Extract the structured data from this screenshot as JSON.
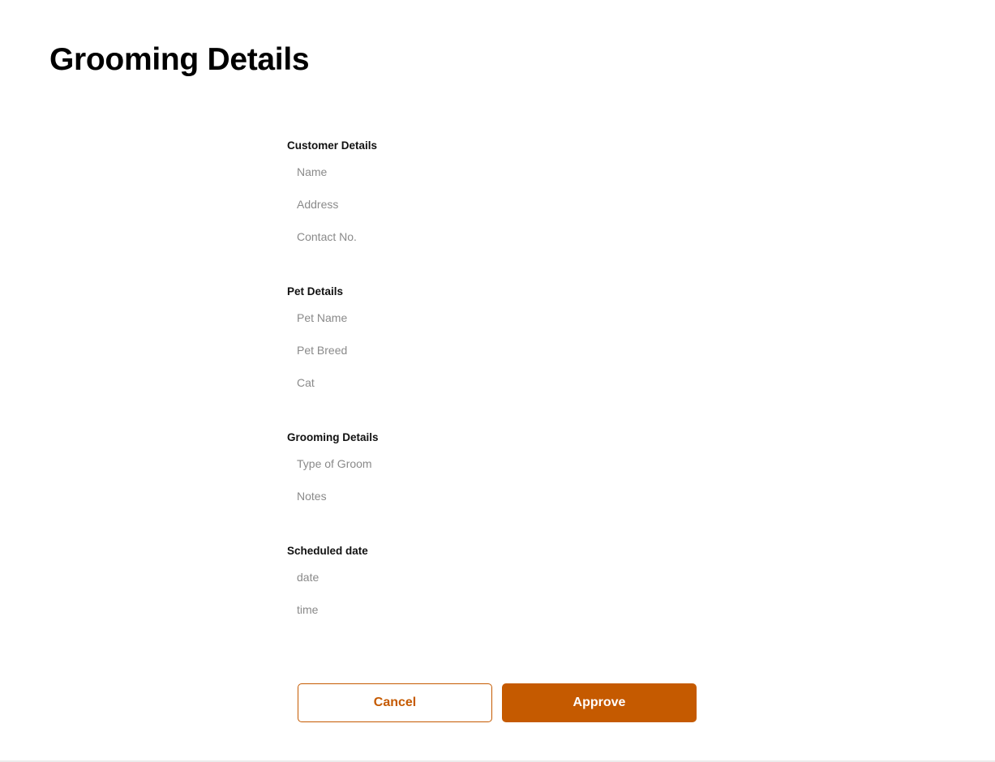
{
  "page": {
    "title": "Grooming Details"
  },
  "customer": {
    "heading": "Customer Details",
    "name_placeholder": "Name",
    "address_placeholder": "Address",
    "contact_placeholder": "Contact No."
  },
  "pet": {
    "heading": "Pet Details",
    "name_placeholder": "Pet Name",
    "breed_placeholder": "Pet Breed",
    "type_placeholder": "Cat"
  },
  "grooming": {
    "heading": "Grooming Details",
    "type_placeholder": "Type of Groom",
    "notes_placeholder": "Notes"
  },
  "schedule": {
    "heading": "Scheduled date",
    "date_placeholder": "date",
    "time_placeholder": "time"
  },
  "actions": {
    "cancel_label": "Cancel",
    "approve_label": "Approve"
  },
  "colors": {
    "accent": "#c55a00",
    "placeholder": "#8a8a8a",
    "background": "#ffffff"
  }
}
